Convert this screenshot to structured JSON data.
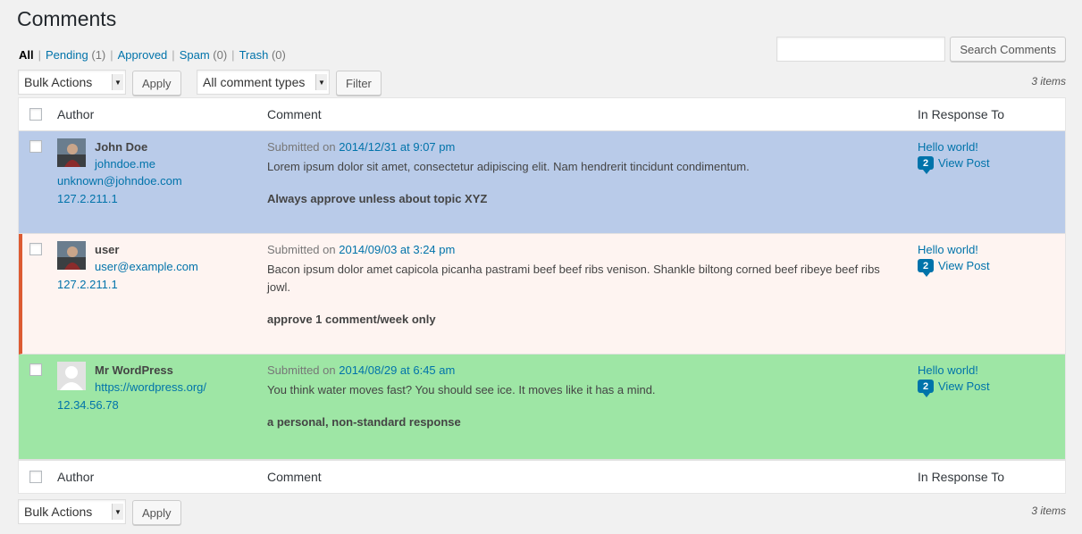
{
  "page": {
    "title": "Comments"
  },
  "filters": {
    "all": "All",
    "pending": "Pending",
    "pending_count": "(1)",
    "approved": "Approved",
    "spam": "Spam",
    "spam_count": "(0)",
    "trash": "Trash",
    "trash_count": "(0)",
    "sep": "|"
  },
  "search": {
    "value": "",
    "placeholder": "",
    "button": "Search Comments"
  },
  "toolbar": {
    "bulk_actions": "Bulk Actions",
    "apply": "Apply",
    "comment_types": "All comment types",
    "filter": "Filter",
    "items": "3 items"
  },
  "columns": {
    "author": "Author",
    "comment": "Comment",
    "response": "In Response To"
  },
  "rows": [
    {
      "author": "John Doe",
      "url": "johndoe.me",
      "email": "unknown@johndoe.com",
      "ip": "127.2.211.1",
      "submitted_prefix": "Submitted on",
      "date": "2014/12/31 at 9:07 pm",
      "text": "Lorem ipsum dolor sit amet, consectetur adipiscing elit. Nam hendrerit tincidunt condimentum.",
      "note": "Always approve unless about topic XYZ",
      "post": "Hello world!",
      "comment_count": "2",
      "view_post": "View Post",
      "bg": "#b9cbe9"
    },
    {
      "author": "user",
      "email": "user@example.com",
      "ip": "127.2.211.1",
      "submitted_prefix": "Submitted on",
      "date": "2014/09/03 at 3:24 pm",
      "text": "Bacon ipsum dolor amet capicola picanha pastrami beef beef ribs venison. Shankle biltong corned beef ribeye beef ribs jowl.",
      "note": "approve 1 comment/week only",
      "post": "Hello world!",
      "comment_count": "2",
      "view_post": "View Post",
      "bg": "#fef4f1",
      "accent": "#dc5b32"
    },
    {
      "author": "Mr WordPress",
      "url": "https://wordpress.org/",
      "ip": "12.34.56.78",
      "submitted_prefix": "Submitted on",
      "date": "2014/08/29 at 6:45 am",
      "text": "You think water moves fast? You should see ice. It moves like it has a mind.",
      "note": "a personal, non-standard response",
      "post": "Hello world!",
      "comment_count": "2",
      "view_post": "View Post",
      "bg": "#9ee6a5"
    }
  ],
  "icons": {
    "dropdown": "chevron-down-icon",
    "comment_count": "comment-bubble-icon",
    "avatar": "avatar-icon"
  }
}
